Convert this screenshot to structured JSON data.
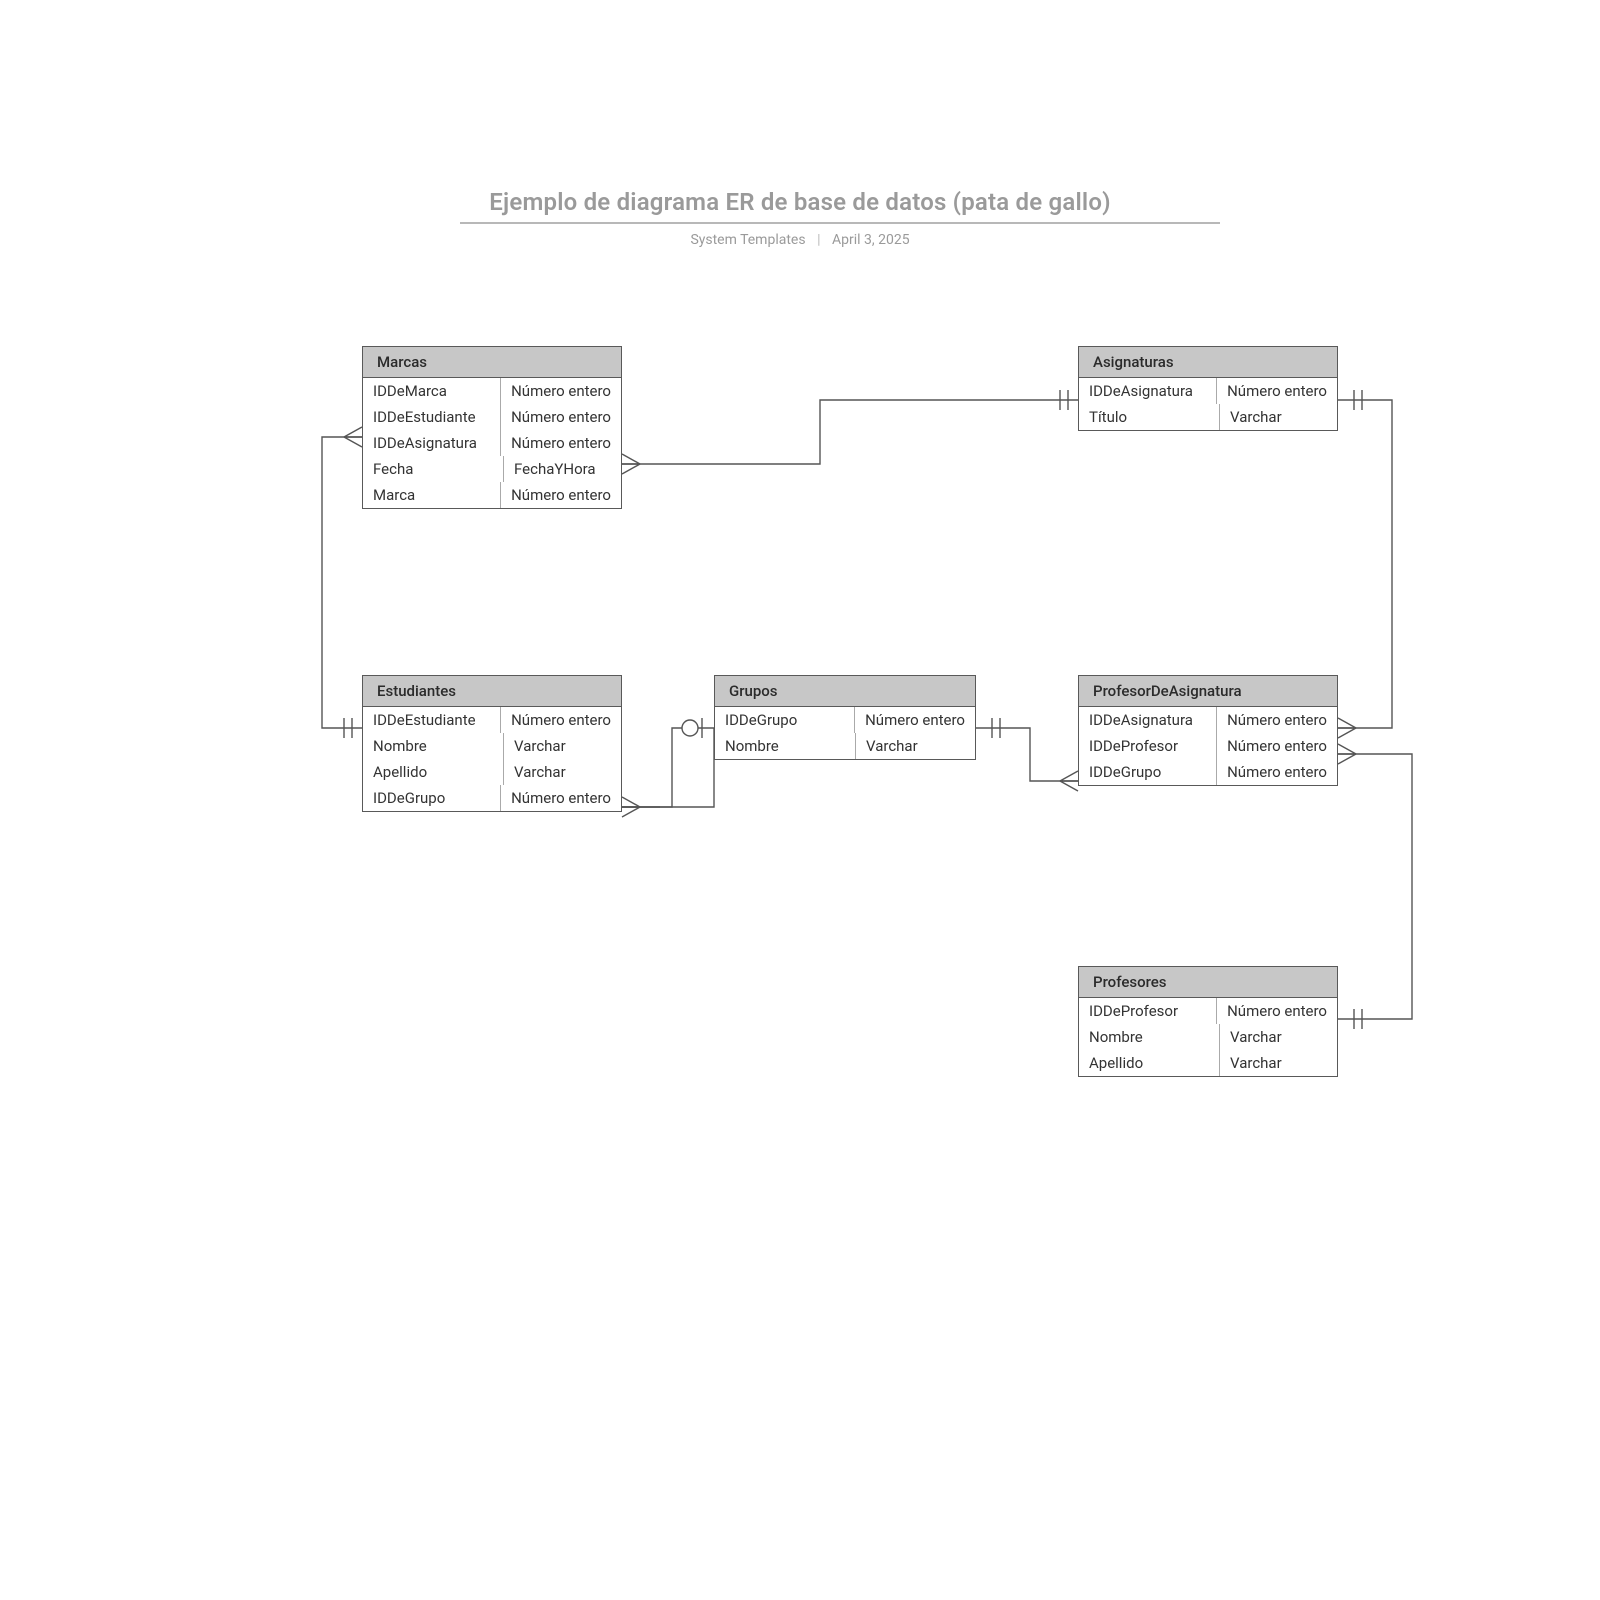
{
  "header": {
    "title": "Ejemplo de diagrama ER de base de datos (pata de gallo)",
    "author": "System Templates",
    "date": "April 3, 2025"
  },
  "entities": {
    "marcas": {
      "name": "Marcas",
      "fields": [
        {
          "name": "IDDeMarca",
          "type": "Número entero"
        },
        {
          "name": "IDDeEstudiante",
          "type": "Número entero"
        },
        {
          "name": "IDDeAsignatura",
          "type": "Número entero"
        },
        {
          "name": "Fecha",
          "type": "FechaYHora"
        },
        {
          "name": "Marca",
          "type": "Número entero"
        }
      ]
    },
    "asignaturas": {
      "name": "Asignaturas",
      "fields": [
        {
          "name": "IDDeAsignatura",
          "type": "Número entero"
        },
        {
          "name": "Título",
          "type": "Varchar"
        }
      ]
    },
    "estudiantes": {
      "name": "Estudiantes",
      "fields": [
        {
          "name": "IDDeEstudiante",
          "type": "Número entero"
        },
        {
          "name": "Nombre",
          "type": "Varchar"
        },
        {
          "name": "Apellido",
          "type": "Varchar"
        },
        {
          "name": "IDDeGrupo",
          "type": "Número entero"
        }
      ]
    },
    "grupos": {
      "name": "Grupos",
      "fields": [
        {
          "name": "IDDeGrupo",
          "type": "Número entero"
        },
        {
          "name": "Nombre",
          "type": "Varchar"
        }
      ]
    },
    "profesorDeAsignatura": {
      "name": "ProfesorDeAsignatura",
      "fields": [
        {
          "name": "IDDeAsignatura",
          "type": "Número entero"
        },
        {
          "name": "IDDeProfesor",
          "type": "Número entero"
        },
        {
          "name": "IDDeGrupo",
          "type": "Número entero"
        }
      ]
    },
    "profesores": {
      "name": "Profesores",
      "fields": [
        {
          "name": "IDDeProfesor",
          "type": "Número entero"
        },
        {
          "name": "Nombre",
          "type": "Varchar"
        },
        {
          "name": "Apellido",
          "type": "Varchar"
        }
      ]
    }
  },
  "relations": [
    {
      "from": "Marcas.IDDeAsignatura",
      "to": "Asignaturas.IDDeAsignatura",
      "type": "many-to-one"
    },
    {
      "from": "Marcas.IDDeEstudiante",
      "to": "Estudiantes.IDDeEstudiante",
      "type": "many-to-one"
    },
    {
      "from": "Estudiantes.IDDeGrupo",
      "to": "Grupos.IDDeGrupo",
      "type": "many-to-zero-or-one"
    },
    {
      "from": "ProfesorDeAsignatura.IDDeGrupo",
      "to": "Grupos.IDDeGrupo",
      "type": "many-to-one"
    },
    {
      "from": "ProfesorDeAsignatura.IDDeAsignatura",
      "to": "Asignaturas.IDDeAsignatura",
      "type": "many-to-one"
    },
    {
      "from": "ProfesorDeAsignatura.IDDeProfesor",
      "to": "Profesores.IDDeProfesor",
      "type": "many-to-one"
    }
  ]
}
